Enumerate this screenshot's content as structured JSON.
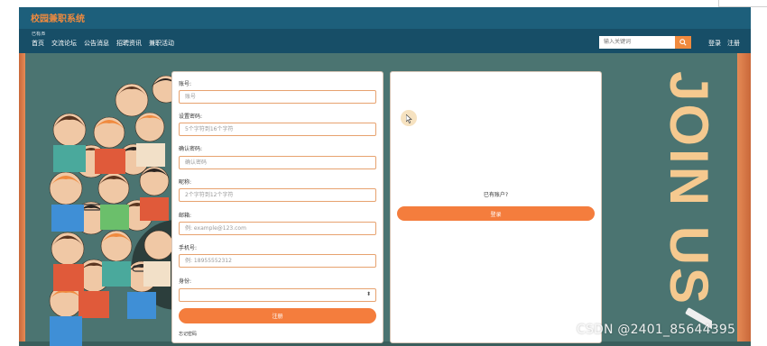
{
  "header": {
    "brand": "校园兼职系统",
    "breadcrumb": "已有/B",
    "nav": [
      "首页",
      "交流论坛",
      "公告消息",
      "招聘资讯",
      "兼职活动"
    ],
    "search_placeholder": "输入关键词",
    "user_links": [
      "登录",
      "注册"
    ]
  },
  "register_form": {
    "fields": [
      {
        "label": "账号:",
        "placeholder": "账号"
      },
      {
        "label": "设置密码:",
        "placeholder": "5个字符到16个字符"
      },
      {
        "label": "确认密码:",
        "placeholder": "确认密码"
      },
      {
        "label": "昵称:",
        "placeholder": "2个字符到12个字符"
      },
      {
        "label": "邮箱:",
        "placeholder": "例: example@123.com"
      },
      {
        "label": "手机号:",
        "placeholder": "例: 18955552312"
      }
    ],
    "identity_label": "身份:",
    "identity_value": "",
    "submit_label": "注册",
    "forgot_label": "忘记密码"
  },
  "login_panel": {
    "prompt": "已有账户?",
    "login_label": "登录"
  },
  "background": {
    "slogan": "JOIN US"
  },
  "watermark": "CSDN @2401_85644395",
  "colors": {
    "header_dark": "#1d5f7b",
    "nav_dark": "#174e67",
    "accent": "#f47d3d",
    "chalkboard": "#4b7471",
    "slogan": "#f5c98f"
  },
  "icons": [
    "search-icon",
    "select-arrow-icon",
    "cursor-icon"
  ]
}
